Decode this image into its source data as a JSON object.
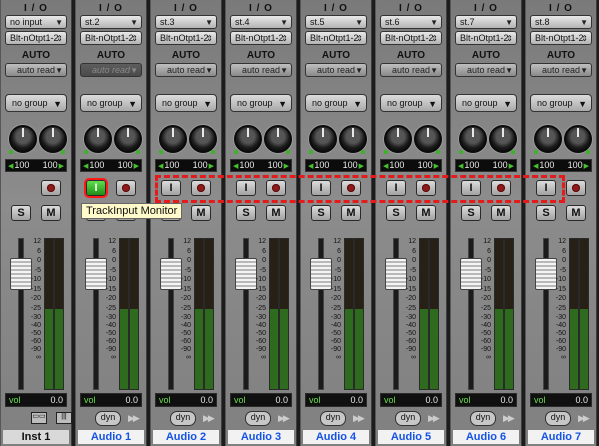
{
  "io_title": "I / O",
  "auto_label": "AUTO",
  "vol_label": "vol",
  "dyn_label": "dyn",
  "tooltip": "TrackInput Monitor",
  "input_monitor_label": "I",
  "solo_label": "S",
  "mute_label": "M",
  "pan_left": "100",
  "pan_right": "100",
  "meter_scale": [
    "12",
    "6",
    "0",
    "-5",
    "-10",
    "-15",
    "-20",
    "-25",
    "-30",
    "-40",
    "-50",
    "-60",
    "-90",
    "∞"
  ],
  "colors": {
    "track_name_blue": "#1453e6",
    "dash_highlight": "#e51a1a",
    "input_active": "#2fb822",
    "meter_green": "#2f6b1e"
  },
  "tracks": [
    {
      "name": "Inst 1",
      "input": "no input",
      "output": "Blt-nOtpt1-2",
      "auto": "auto read",
      "group": "no group",
      "vol": "0.0",
      "has_input_monitor": false,
      "input_active": false
    },
    {
      "name": "Audio 1",
      "input": "st.2",
      "output": "Blt-nOtpt1-2",
      "auto": "auto read",
      "group": "no group",
      "vol": "0.0",
      "has_input_monitor": true,
      "input_active": true
    },
    {
      "name": "Audio 2",
      "input": "st.3",
      "output": "Blt-nOtpt1-2",
      "auto": "auto read",
      "group": "no group",
      "vol": "0.0",
      "has_input_monitor": true,
      "input_active": false
    },
    {
      "name": "Audio 3",
      "input": "st.4",
      "output": "Blt-nOtpt1-2",
      "auto": "auto read",
      "group": "no group",
      "vol": "0.0",
      "has_input_monitor": true,
      "input_active": false
    },
    {
      "name": "Audio 4",
      "input": "st.5",
      "output": "Blt-nOtpt1-2",
      "auto": "auto read",
      "group": "no group",
      "vol": "0.0",
      "has_input_monitor": true,
      "input_active": false
    },
    {
      "name": "Audio 5",
      "input": "st.6",
      "output": "Blt-nOtpt1-2",
      "auto": "auto read",
      "group": "no group",
      "vol": "0.0",
      "has_input_monitor": true,
      "input_active": false
    },
    {
      "name": "Audio 6",
      "input": "st.7",
      "output": "Blt-nOtpt1-2",
      "auto": "auto read",
      "group": "no group",
      "vol": "0.0",
      "has_input_monitor": true,
      "input_active": false
    },
    {
      "name": "Audio 7",
      "input": "st.8",
      "output": "Blt-nOtpt1-2",
      "auto": "auto read",
      "group": "no group",
      "vol": "0.0",
      "has_input_monitor": true,
      "input_active": false
    }
  ]
}
